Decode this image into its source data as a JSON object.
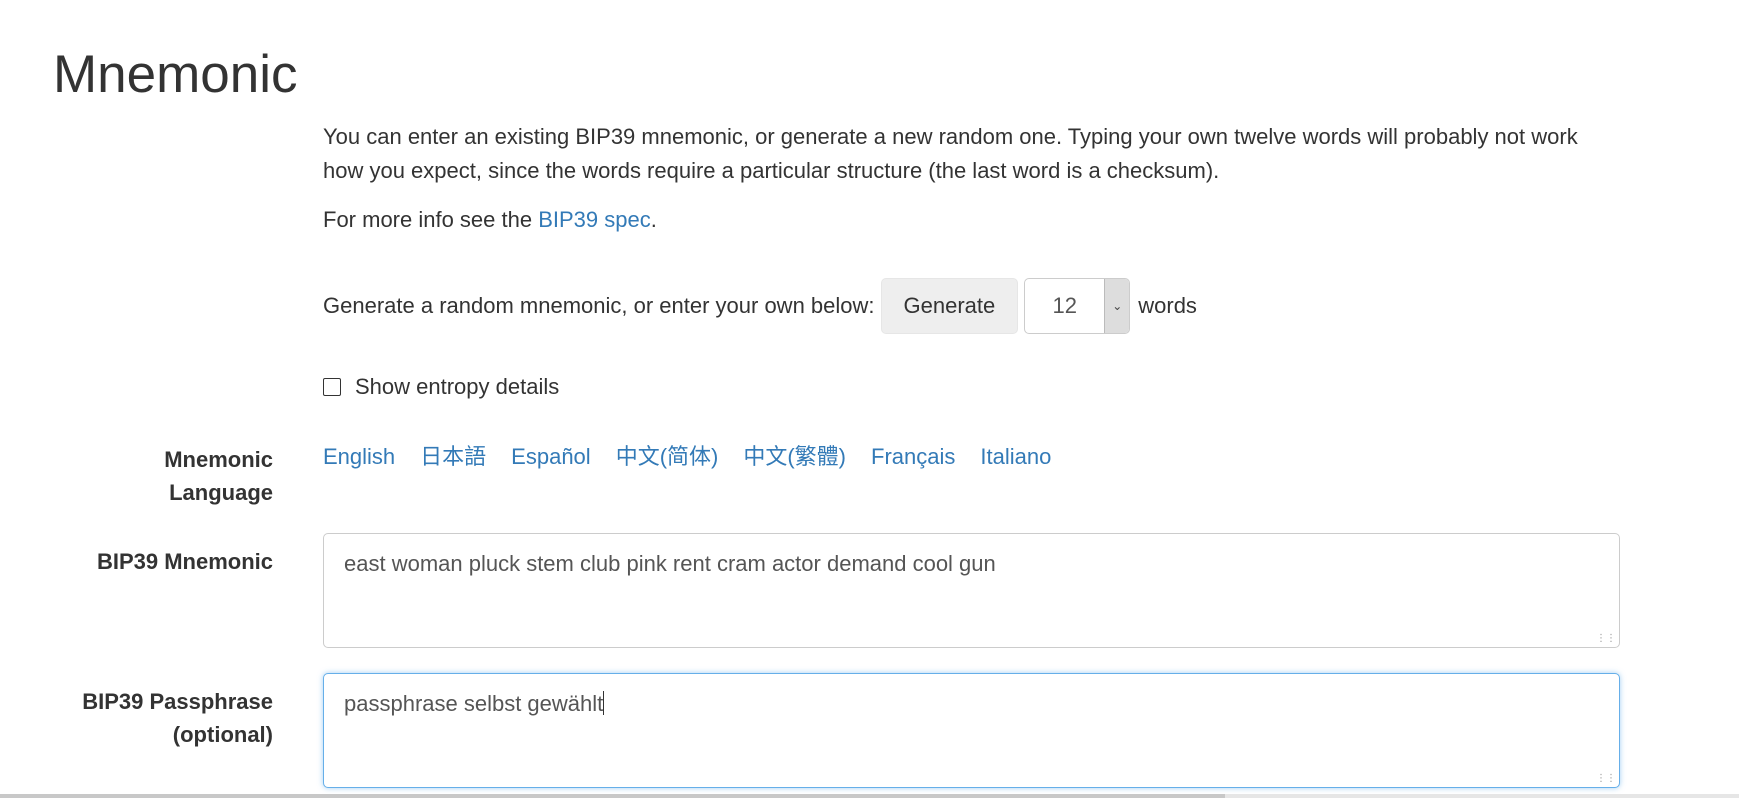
{
  "section": {
    "title": "Mnemonic"
  },
  "intro": {
    "text": "You can enter an existing BIP39 mnemonic, or generate a new random one. Typing your own twelve words will probably not work how you expect, since the words require a particular structure (the last word is a checksum).",
    "more_info_prefix": "For more info see the ",
    "more_info_link": "BIP39 spec",
    "more_info_suffix": "."
  },
  "generator": {
    "prompt": "Generate a random mnemonic, or enter your own below:",
    "button_label": "Generate",
    "word_count": "12",
    "words_label": "words"
  },
  "entropy": {
    "checkbox_label": "Show entropy details",
    "checked": false
  },
  "language": {
    "label_line1": "Mnemonic",
    "label_line2": "Language",
    "options": [
      "English",
      "日本語",
      "Español",
      "中文(简体)",
      "中文(繁體)",
      "Français",
      "Italiano"
    ]
  },
  "mnemonic": {
    "label": "BIP39 Mnemonic",
    "value": "east woman pluck stem club pink rent cram actor demand cool gun"
  },
  "passphrase": {
    "label_line1": "BIP39 Passphrase",
    "label_line2": "(optional)",
    "value": "passphrase selbst gewählt"
  },
  "colors": {
    "link": "#337ab7",
    "focus_border": "#66afe9"
  }
}
